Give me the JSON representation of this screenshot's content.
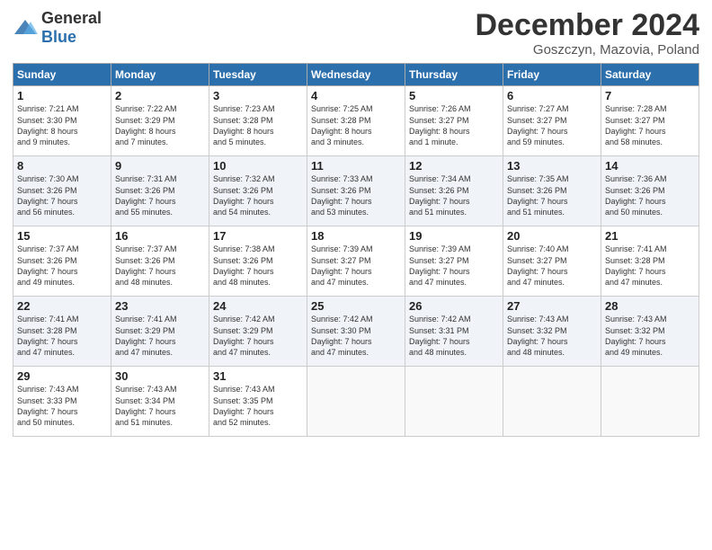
{
  "header": {
    "logo_general": "General",
    "logo_blue": "Blue",
    "month_title": "December 2024",
    "location": "Goszczyn, Mazovia, Poland"
  },
  "weekdays": [
    "Sunday",
    "Monday",
    "Tuesday",
    "Wednesday",
    "Thursday",
    "Friday",
    "Saturday"
  ],
  "weeks": [
    [
      {
        "day": "1",
        "info": "Sunrise: 7:21 AM\nSunset: 3:30 PM\nDaylight: 8 hours\nand 9 minutes."
      },
      {
        "day": "2",
        "info": "Sunrise: 7:22 AM\nSunset: 3:29 PM\nDaylight: 8 hours\nand 7 minutes."
      },
      {
        "day": "3",
        "info": "Sunrise: 7:23 AM\nSunset: 3:28 PM\nDaylight: 8 hours\nand 5 minutes."
      },
      {
        "day": "4",
        "info": "Sunrise: 7:25 AM\nSunset: 3:28 PM\nDaylight: 8 hours\nand 3 minutes."
      },
      {
        "day": "5",
        "info": "Sunrise: 7:26 AM\nSunset: 3:27 PM\nDaylight: 8 hours\nand 1 minute."
      },
      {
        "day": "6",
        "info": "Sunrise: 7:27 AM\nSunset: 3:27 PM\nDaylight: 7 hours\nand 59 minutes."
      },
      {
        "day": "7",
        "info": "Sunrise: 7:28 AM\nSunset: 3:27 PM\nDaylight: 7 hours\nand 58 minutes."
      }
    ],
    [
      {
        "day": "8",
        "info": "Sunrise: 7:30 AM\nSunset: 3:26 PM\nDaylight: 7 hours\nand 56 minutes."
      },
      {
        "day": "9",
        "info": "Sunrise: 7:31 AM\nSunset: 3:26 PM\nDaylight: 7 hours\nand 55 minutes."
      },
      {
        "day": "10",
        "info": "Sunrise: 7:32 AM\nSunset: 3:26 PM\nDaylight: 7 hours\nand 54 minutes."
      },
      {
        "day": "11",
        "info": "Sunrise: 7:33 AM\nSunset: 3:26 PM\nDaylight: 7 hours\nand 53 minutes."
      },
      {
        "day": "12",
        "info": "Sunrise: 7:34 AM\nSunset: 3:26 PM\nDaylight: 7 hours\nand 51 minutes."
      },
      {
        "day": "13",
        "info": "Sunrise: 7:35 AM\nSunset: 3:26 PM\nDaylight: 7 hours\nand 51 minutes."
      },
      {
        "day": "14",
        "info": "Sunrise: 7:36 AM\nSunset: 3:26 PM\nDaylight: 7 hours\nand 50 minutes."
      }
    ],
    [
      {
        "day": "15",
        "info": "Sunrise: 7:37 AM\nSunset: 3:26 PM\nDaylight: 7 hours\nand 49 minutes."
      },
      {
        "day": "16",
        "info": "Sunrise: 7:37 AM\nSunset: 3:26 PM\nDaylight: 7 hours\nand 48 minutes."
      },
      {
        "day": "17",
        "info": "Sunrise: 7:38 AM\nSunset: 3:26 PM\nDaylight: 7 hours\nand 48 minutes."
      },
      {
        "day": "18",
        "info": "Sunrise: 7:39 AM\nSunset: 3:27 PM\nDaylight: 7 hours\nand 47 minutes."
      },
      {
        "day": "19",
        "info": "Sunrise: 7:39 AM\nSunset: 3:27 PM\nDaylight: 7 hours\nand 47 minutes."
      },
      {
        "day": "20",
        "info": "Sunrise: 7:40 AM\nSunset: 3:27 PM\nDaylight: 7 hours\nand 47 minutes."
      },
      {
        "day": "21",
        "info": "Sunrise: 7:41 AM\nSunset: 3:28 PM\nDaylight: 7 hours\nand 47 minutes."
      }
    ],
    [
      {
        "day": "22",
        "info": "Sunrise: 7:41 AM\nSunset: 3:28 PM\nDaylight: 7 hours\nand 47 minutes."
      },
      {
        "day": "23",
        "info": "Sunrise: 7:41 AM\nSunset: 3:29 PM\nDaylight: 7 hours\nand 47 minutes."
      },
      {
        "day": "24",
        "info": "Sunrise: 7:42 AM\nSunset: 3:29 PM\nDaylight: 7 hours\nand 47 minutes."
      },
      {
        "day": "25",
        "info": "Sunrise: 7:42 AM\nSunset: 3:30 PM\nDaylight: 7 hours\nand 47 minutes."
      },
      {
        "day": "26",
        "info": "Sunrise: 7:42 AM\nSunset: 3:31 PM\nDaylight: 7 hours\nand 48 minutes."
      },
      {
        "day": "27",
        "info": "Sunrise: 7:43 AM\nSunset: 3:32 PM\nDaylight: 7 hours\nand 48 minutes."
      },
      {
        "day": "28",
        "info": "Sunrise: 7:43 AM\nSunset: 3:32 PM\nDaylight: 7 hours\nand 49 minutes."
      }
    ],
    [
      {
        "day": "29",
        "info": "Sunrise: 7:43 AM\nSunset: 3:33 PM\nDaylight: 7 hours\nand 50 minutes."
      },
      {
        "day": "30",
        "info": "Sunrise: 7:43 AM\nSunset: 3:34 PM\nDaylight: 7 hours\nand 51 minutes."
      },
      {
        "day": "31",
        "info": "Sunrise: 7:43 AM\nSunset: 3:35 PM\nDaylight: 7 hours\nand 52 minutes."
      },
      {
        "day": "",
        "info": ""
      },
      {
        "day": "",
        "info": ""
      },
      {
        "day": "",
        "info": ""
      },
      {
        "day": "",
        "info": ""
      }
    ]
  ]
}
